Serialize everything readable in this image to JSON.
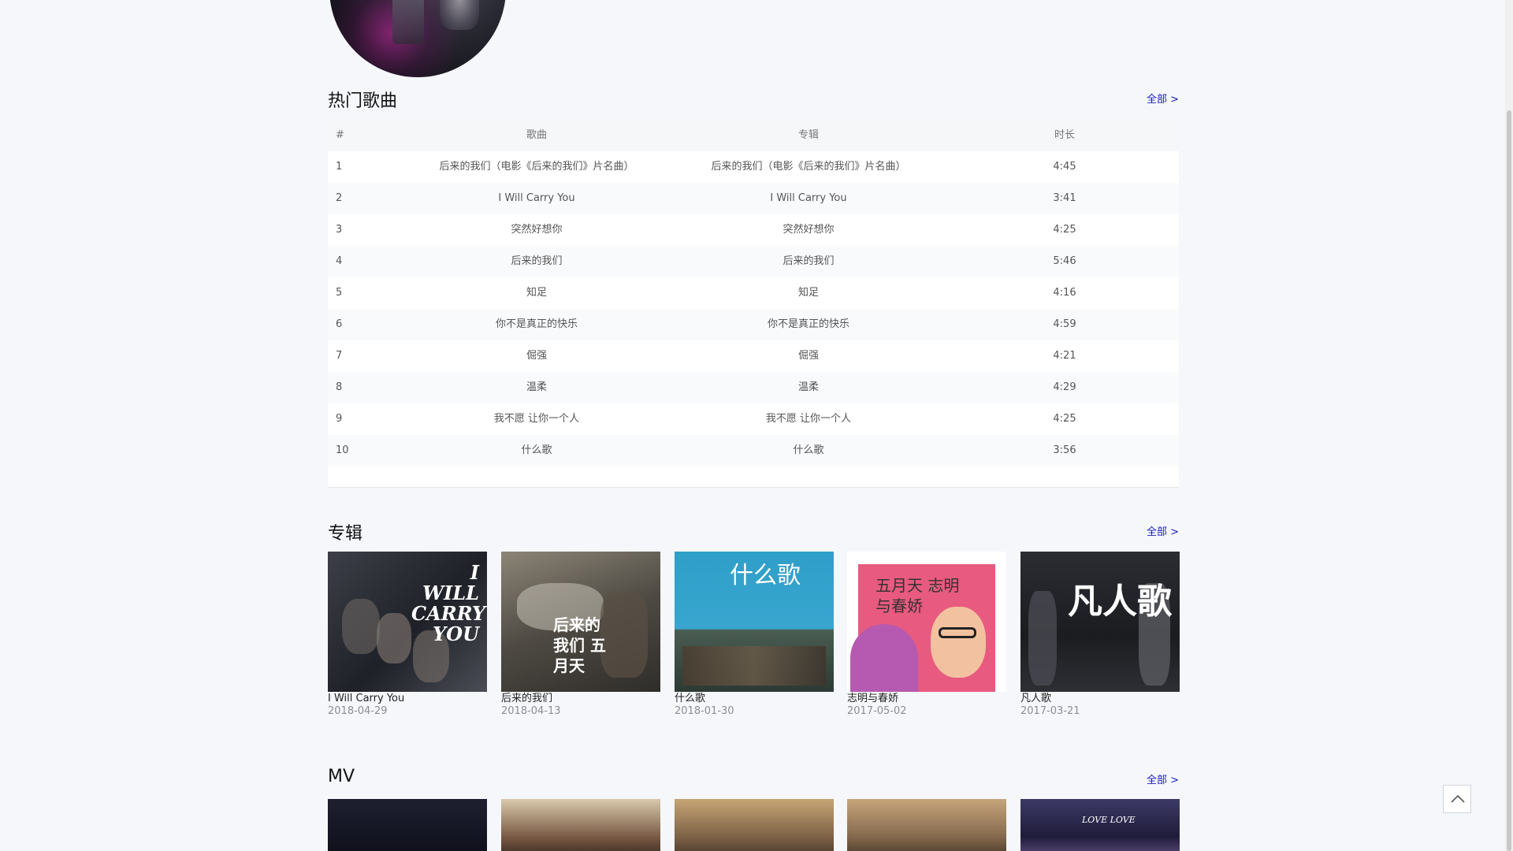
{
  "sections": {
    "hot_songs": {
      "title": "热门歌曲",
      "more": "全部 >"
    },
    "albums": {
      "title": "专辑",
      "more": "全部 >"
    },
    "mv": {
      "title": "MV",
      "more": "全部 >"
    }
  },
  "song_table": {
    "headers": [
      "#",
      "歌曲",
      "专辑",
      "时长"
    ],
    "rows": [
      {
        "idx": "1",
        "song": "后来的我们（电影《后来的我们》片名曲）",
        "album": "后来的我们（电影《后来的我们》片名曲）",
        "duration": "4:45"
      },
      {
        "idx": "2",
        "song": "I Will Carry You",
        "album": "I Will Carry You",
        "duration": "3:41"
      },
      {
        "idx": "3",
        "song": "突然好想你",
        "album": "突然好想你",
        "duration": "4:25"
      },
      {
        "idx": "4",
        "song": "后来的我们",
        "album": "后来的我们",
        "duration": "5:46"
      },
      {
        "idx": "5",
        "song": "知足",
        "album": "知足",
        "duration": "4:16"
      },
      {
        "idx": "6",
        "song": "你不是真正的快乐",
        "album": "你不是真正的快乐",
        "duration": "4:59"
      },
      {
        "idx": "7",
        "song": "倔强",
        "album": "倔强",
        "duration": "4:21"
      },
      {
        "idx": "8",
        "song": "温柔",
        "album": "温柔",
        "duration": "4:29"
      },
      {
        "idx": "9",
        "song": "我不愿 让你一个人",
        "album": "我不愿 让你一个人",
        "duration": "4:25"
      },
      {
        "idx": "10",
        "song": "什么歌",
        "album": "什么歌",
        "duration": "3:56"
      }
    ]
  },
  "albums": [
    {
      "name": "I Will Carry You",
      "date": "2018-04-29",
      "cover_text": "I WILL CARRY YOU"
    },
    {
      "name": "后来的我们",
      "date": "2018-04-13",
      "cover_text": "后来的我们 五月天"
    },
    {
      "name": "什么歌",
      "date": "2018-01-30",
      "cover_text": "什么歌"
    },
    {
      "name": "志明与春娇",
      "date": "2017-05-02",
      "cover_text": "五月天 志明与春娇"
    },
    {
      "name": "凡人歌",
      "date": "2017-03-21",
      "cover_text": "凡人歌"
    }
  ],
  "mv_thumbs": [
    {
      "caption": ""
    },
    {
      "caption": ""
    },
    {
      "caption": ""
    },
    {
      "caption": ""
    },
    {
      "caption": "LOVE LOVE"
    }
  ],
  "colors": {
    "link": "#1a1abf",
    "background": "#f5f7fb"
  },
  "icons": {
    "back_to_top": "chevron-up-icon"
  }
}
